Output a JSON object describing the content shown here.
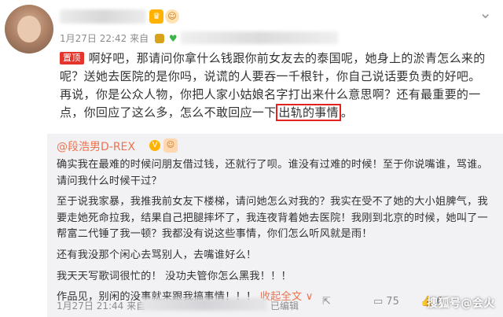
{
  "post": {
    "time": "1月27日 22:42",
    "from_label": "来自",
    "pin_label": "置顶",
    "text_part1": "啊好吧，那请问你拿什么钱跟你前女友去的泰国呢，她身上的淤青怎么来的呢？送她去医院的是你吗，说谎的人要吞一千根针，你自己说话要负责的好吧。再说，你是公众人物，你把人家小姑娘名字打出来什么意思啊？还有最重要的一点，你回应了这么多，怎么不敢回应一下",
    "text_highlight": "出轨的事情",
    "text_part2": "。",
    "menu_icon": "chevron-down-icon"
  },
  "quote": {
    "username": "@段浩男D-REX",
    "paragraphs": [
      "确实我在最难的时候问朋友借过钱，还就行了呗。谁没有过难的时候！至于你说嘴谁，骂谁。请问我什么时候干过？",
      "至于说我家暴，我推我前女友下楼梯，请问她怎么对我的？我实在受不了她的大小姐脾气，我要走她死命拉我，结果自己把腿摔坏了，我连夜背着她去医院！我刚到北京的时候，她叫了一帮富二代锤了我一顿？我都没有说这些事情，你们怎么听风就是雨！",
      "还有我没那个闲心去骂别人，去嘴谁好么！",
      "我天天写歌词很忙的！ 没功夫管你怎么黑我！！！",
      "作品见，别闲的没事就来跟我搞事情！！！"
    ],
    "expand_label": "收起全文 ∨",
    "time": "1月27日 21:44",
    "from_label": "来自",
    "edited_label": "已编辑",
    "comment_count": "75",
    "like_count": "6"
  },
  "watermark": "搜狐号@会火"
}
